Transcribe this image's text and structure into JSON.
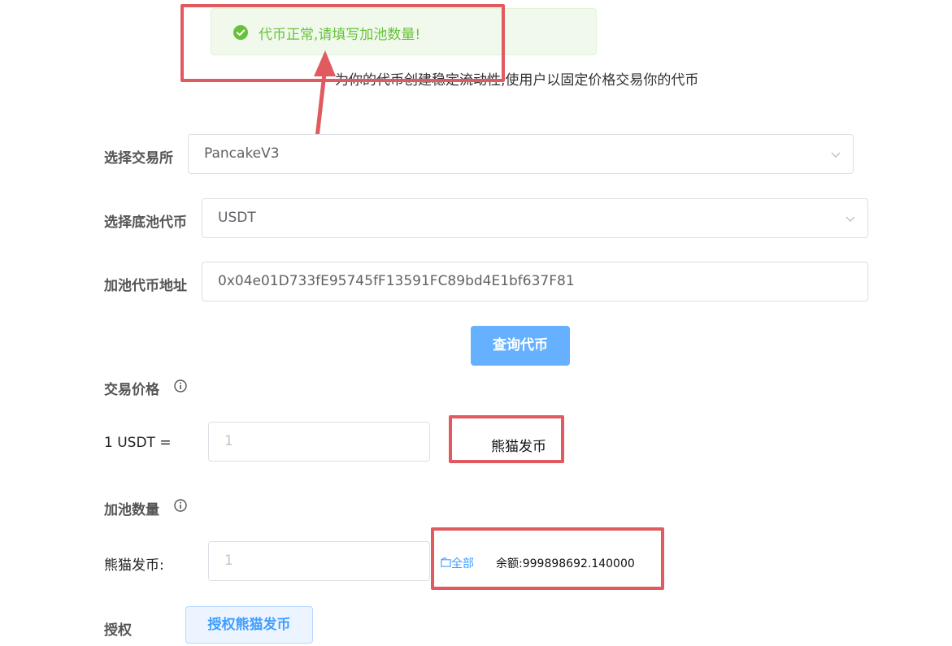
{
  "toast": {
    "message": "代币正常,请填写加池数量!",
    "icon": "check-circle-icon",
    "color": "#67c23a"
  },
  "description": "为你的代币创建稳定流动性,使用户以固定价格交易你的代币",
  "form": {
    "exchange": {
      "label": "选择交易所",
      "value": "PancakeV3"
    },
    "base_token": {
      "label": "选择底池代币",
      "value": "USDT"
    },
    "token_address": {
      "label": "加池代币地址",
      "value": "0x04e01D733fE95745fF13591FC89bd4E1bf637F81"
    },
    "query_button": "查询代币"
  },
  "price": {
    "label": "交易价格",
    "rate_label": "1 USDT =",
    "placeholder": "1",
    "token_name": "熊猫发币"
  },
  "amount": {
    "label": "加池数量",
    "token_label": "熊猫发币:",
    "placeholder": "1",
    "all_link": "全部",
    "balance": "余额:999898692.140000"
  },
  "authorize": {
    "label": "授权",
    "button": "授权熊猫发币"
  },
  "colors": {
    "primary": "#409eff",
    "primary_light": "#66b1ff",
    "highlight": "#e05a5f",
    "success": "#67c23a"
  }
}
